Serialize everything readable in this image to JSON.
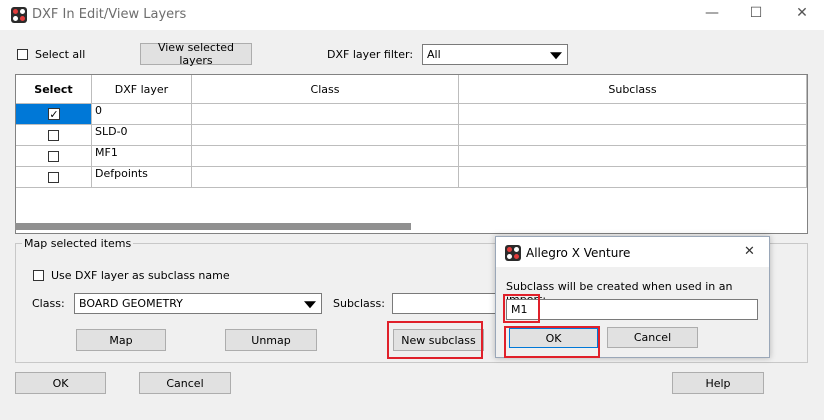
{
  "window": {
    "title": "DXF In Edit/View Layers",
    "minimize": "—",
    "maximize": "☐",
    "close": "✕"
  },
  "top": {
    "select_all_label": "Select all",
    "view_selected_button": "View selected layers",
    "filter_label": "DXF layer filter:",
    "filter_value": "All"
  },
  "table": {
    "headers": [
      "Select",
      "DXF layer",
      "Class",
      "Subclass"
    ],
    "rows": [
      {
        "checked": true,
        "layer": "0",
        "class": "",
        "subclass": ""
      },
      {
        "checked": false,
        "layer": "SLD-0",
        "class": "",
        "subclass": ""
      },
      {
        "checked": false,
        "layer": "MF1",
        "class": "",
        "subclass": ""
      },
      {
        "checked": false,
        "layer": "Defpoints",
        "class": "",
        "subclass": ""
      }
    ]
  },
  "map_group": {
    "title": "Map selected items",
    "use_dxf_label": "Use DXF layer as subclass name",
    "class_label": "Class:",
    "class_value": "BOARD GEOMETRY",
    "subclass_label": "Subclass:",
    "subclass_value": "",
    "map_button": "Map",
    "unmap_button": "Unmap",
    "new_subclass_button": "New subclass"
  },
  "footer": {
    "ok": "OK",
    "cancel": "Cancel",
    "help": "Help"
  },
  "dialog": {
    "title": "Allegro X Venture",
    "close": "✕",
    "prompt": "Subclass will be created when used in an import:",
    "value": "M1",
    "ok": "OK",
    "cancel": "Cancel"
  },
  "colors": {
    "selection": "#0078d7",
    "highlight_box": "#e0202a",
    "default_button_border": "#0078d7"
  }
}
